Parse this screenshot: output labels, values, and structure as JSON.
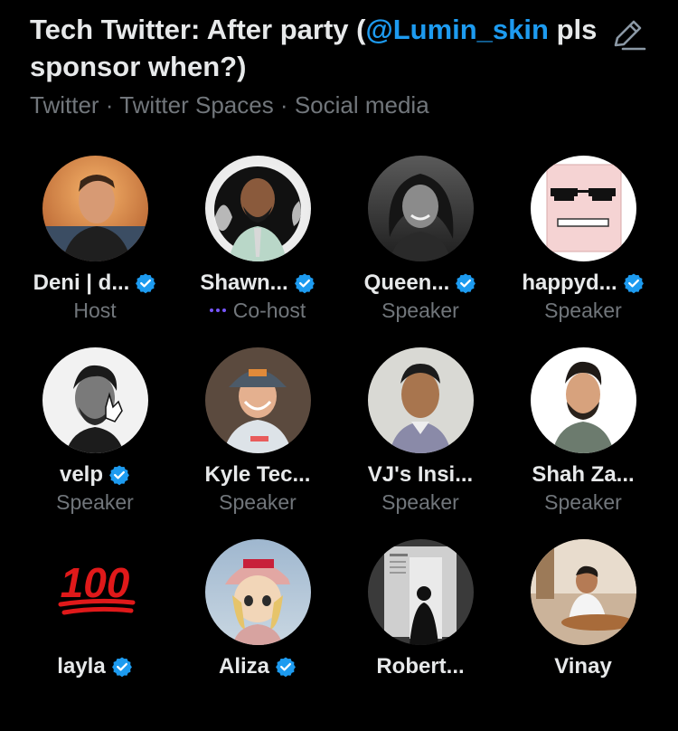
{
  "space": {
    "title_prefix": "Tech Twitter: After party (",
    "title_mention": "@Lumin_skin",
    "title_suffix": " pls sponsor when?)",
    "topics": "Twitter · Twitter Spaces · Social media"
  },
  "colors": {
    "accent": "#1d9bf0",
    "muted": "#71767b",
    "cohost_dots": "#7856ff"
  },
  "participants": [
    {
      "name": "Deni | d...",
      "role": "Host",
      "verified": true,
      "avatar_icon": "avatar-photo-person"
    },
    {
      "name": "Shawn...",
      "role": "Co-host",
      "verified": true,
      "avatar_icon": "avatar-photo-person"
    },
    {
      "name": "Queen...",
      "role": "Speaker",
      "verified": true,
      "avatar_icon": "avatar-photo-person"
    },
    {
      "name": "happyd...",
      "role": "Speaker",
      "verified": true,
      "avatar_icon": "avatar-pixel-sunglasses"
    },
    {
      "name": "velp",
      "role": "Speaker",
      "verified": true,
      "avatar_icon": "avatar-photo-person"
    },
    {
      "name": "Kyle Tec...",
      "role": "Speaker",
      "verified": false,
      "avatar_icon": "avatar-photo-person"
    },
    {
      "name": "VJ's Insi...",
      "role": "Speaker",
      "verified": false,
      "avatar_icon": "avatar-photo-person"
    },
    {
      "name": "Shah Za...",
      "role": "Speaker",
      "verified": false,
      "avatar_icon": "avatar-photo-person"
    },
    {
      "name": "layla",
      "role": "",
      "verified": true,
      "avatar_icon": "hundred-points-emoji",
      "avatar_text": "100"
    },
    {
      "name": "Aliza",
      "role": "",
      "verified": true,
      "avatar_icon": "avatar-anime-character"
    },
    {
      "name": "Robert...",
      "role": "",
      "verified": false,
      "avatar_icon": "avatar-photo-person"
    },
    {
      "name": "Vinay",
      "role": "",
      "verified": false,
      "avatar_icon": "avatar-photo-person"
    }
  ]
}
